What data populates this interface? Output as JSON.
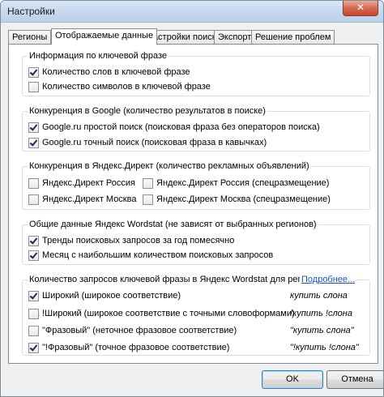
{
  "window": {
    "title": "Настройки",
    "close_glyph": "✕"
  },
  "tabs": [
    {
      "label": "Регионы"
    },
    {
      "label": "Отображаемые данные"
    },
    {
      "label": "Настройки поиска"
    },
    {
      "label": "Экспорт"
    },
    {
      "label": "Решение проблем"
    }
  ],
  "groups": {
    "keyphrase_info": {
      "title": "Информация по ключевой фразе",
      "items": [
        {
          "label": "Количество слов в ключевой фразе",
          "checked": true
        },
        {
          "label": "Количество символов в ключевой фразе",
          "checked": false
        }
      ]
    },
    "google": {
      "title": "Конкуренция в Google (количество результатов в поиске)",
      "items": [
        {
          "label": "Google.ru простой поиск (поисковая фраза без операторов поиска)",
          "checked": true
        },
        {
          "label": "Google.ru точный поиск (поисковая фраза в кавычках)",
          "checked": true
        }
      ]
    },
    "yandex_direct": {
      "title": "Конкуренция в Яндекс.Директ (количество рекламных объявлений)",
      "items": [
        {
          "label": "Яндекс.Директ Россия",
          "checked": false
        },
        {
          "label": "Яндекс.Директ Россия (спецразмещение)",
          "checked": false
        },
        {
          "label": "Яндекс.Директ Москва",
          "checked": false
        },
        {
          "label": "Яндекс.Директ Москва (спецразмещение)",
          "checked": false
        }
      ]
    },
    "wordstat_general": {
      "title": "Общие данные Яндекс Wordstat (не зависят от выбранных регионов)",
      "items": [
        {
          "label": "Тренды поисковых запросов за год помесячно",
          "checked": true
        },
        {
          "label": "Месяц с наибольшим количеством поисковых запросов",
          "checked": true
        }
      ]
    },
    "wordstat_region": {
      "title": "Количество запросов ключевой фразы в Яндекс Wordstat для региона",
      "more_link": "Подробнее...",
      "items": [
        {
          "label": "Широкий (широкое соответствие)",
          "checked": true,
          "example": "купить слона"
        },
        {
          "label": "!Широкий (широкое соответствие с точными словоформами)",
          "checked": false,
          "example": "!купить !слона"
        },
        {
          "label": "\"Фразовый\" (неточное фразовое соответствие)",
          "checked": false,
          "example": "\"купить слона\""
        },
        {
          "label": "\"!Фразовый\" (точное фразовое соответствие)",
          "checked": true,
          "example": "\"!купить !слона\""
        }
      ]
    }
  },
  "buttons": {
    "ok": "OK",
    "cancel": "Отмена"
  }
}
